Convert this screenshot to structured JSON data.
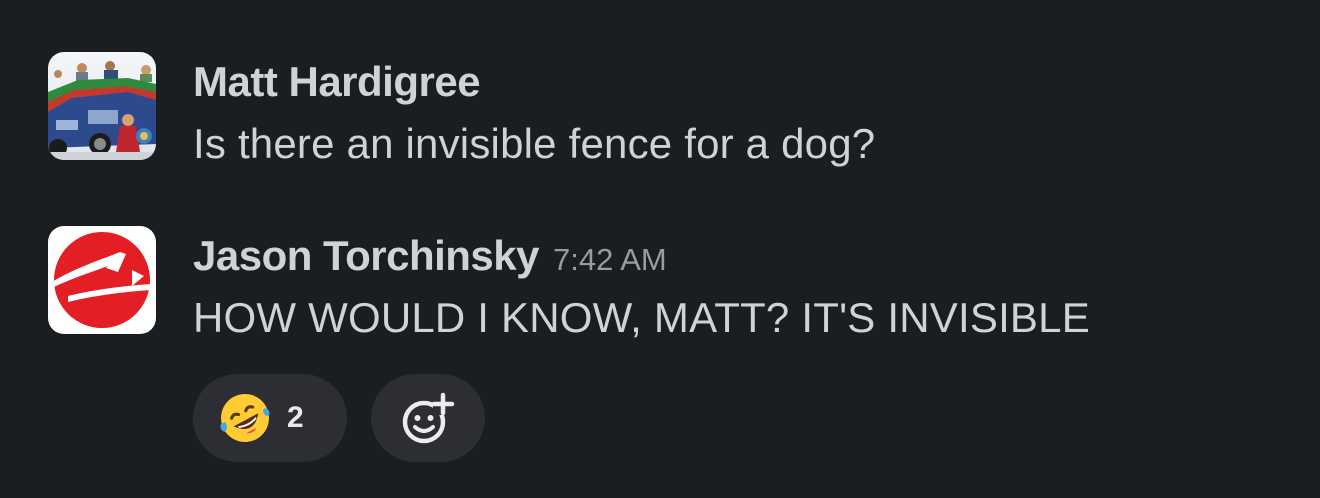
{
  "messages": [
    {
      "author": "Matt Hardigree",
      "timestamp": "",
      "text": "Is there an invisible fence for a dog?",
      "avatar": "photo-avatar"
    },
    {
      "author": "Jason Torchinsky",
      "timestamp": "7:42 AM",
      "text": "HOW WOULD I KNOW, MATT? IT'S INVISIBLE",
      "avatar": "logo-avatar"
    }
  ],
  "reactions": [
    {
      "emoji": "rolling-on-floor-laughing-emoji",
      "count": "2"
    }
  ],
  "add_reaction_icon": "add-reaction-icon",
  "colors": {
    "background": "#1a1d21",
    "text": "#d1d2d3",
    "timestamp": "#9a9b9d",
    "pill": "#2c2e33",
    "logo_red": "#e31e24"
  }
}
